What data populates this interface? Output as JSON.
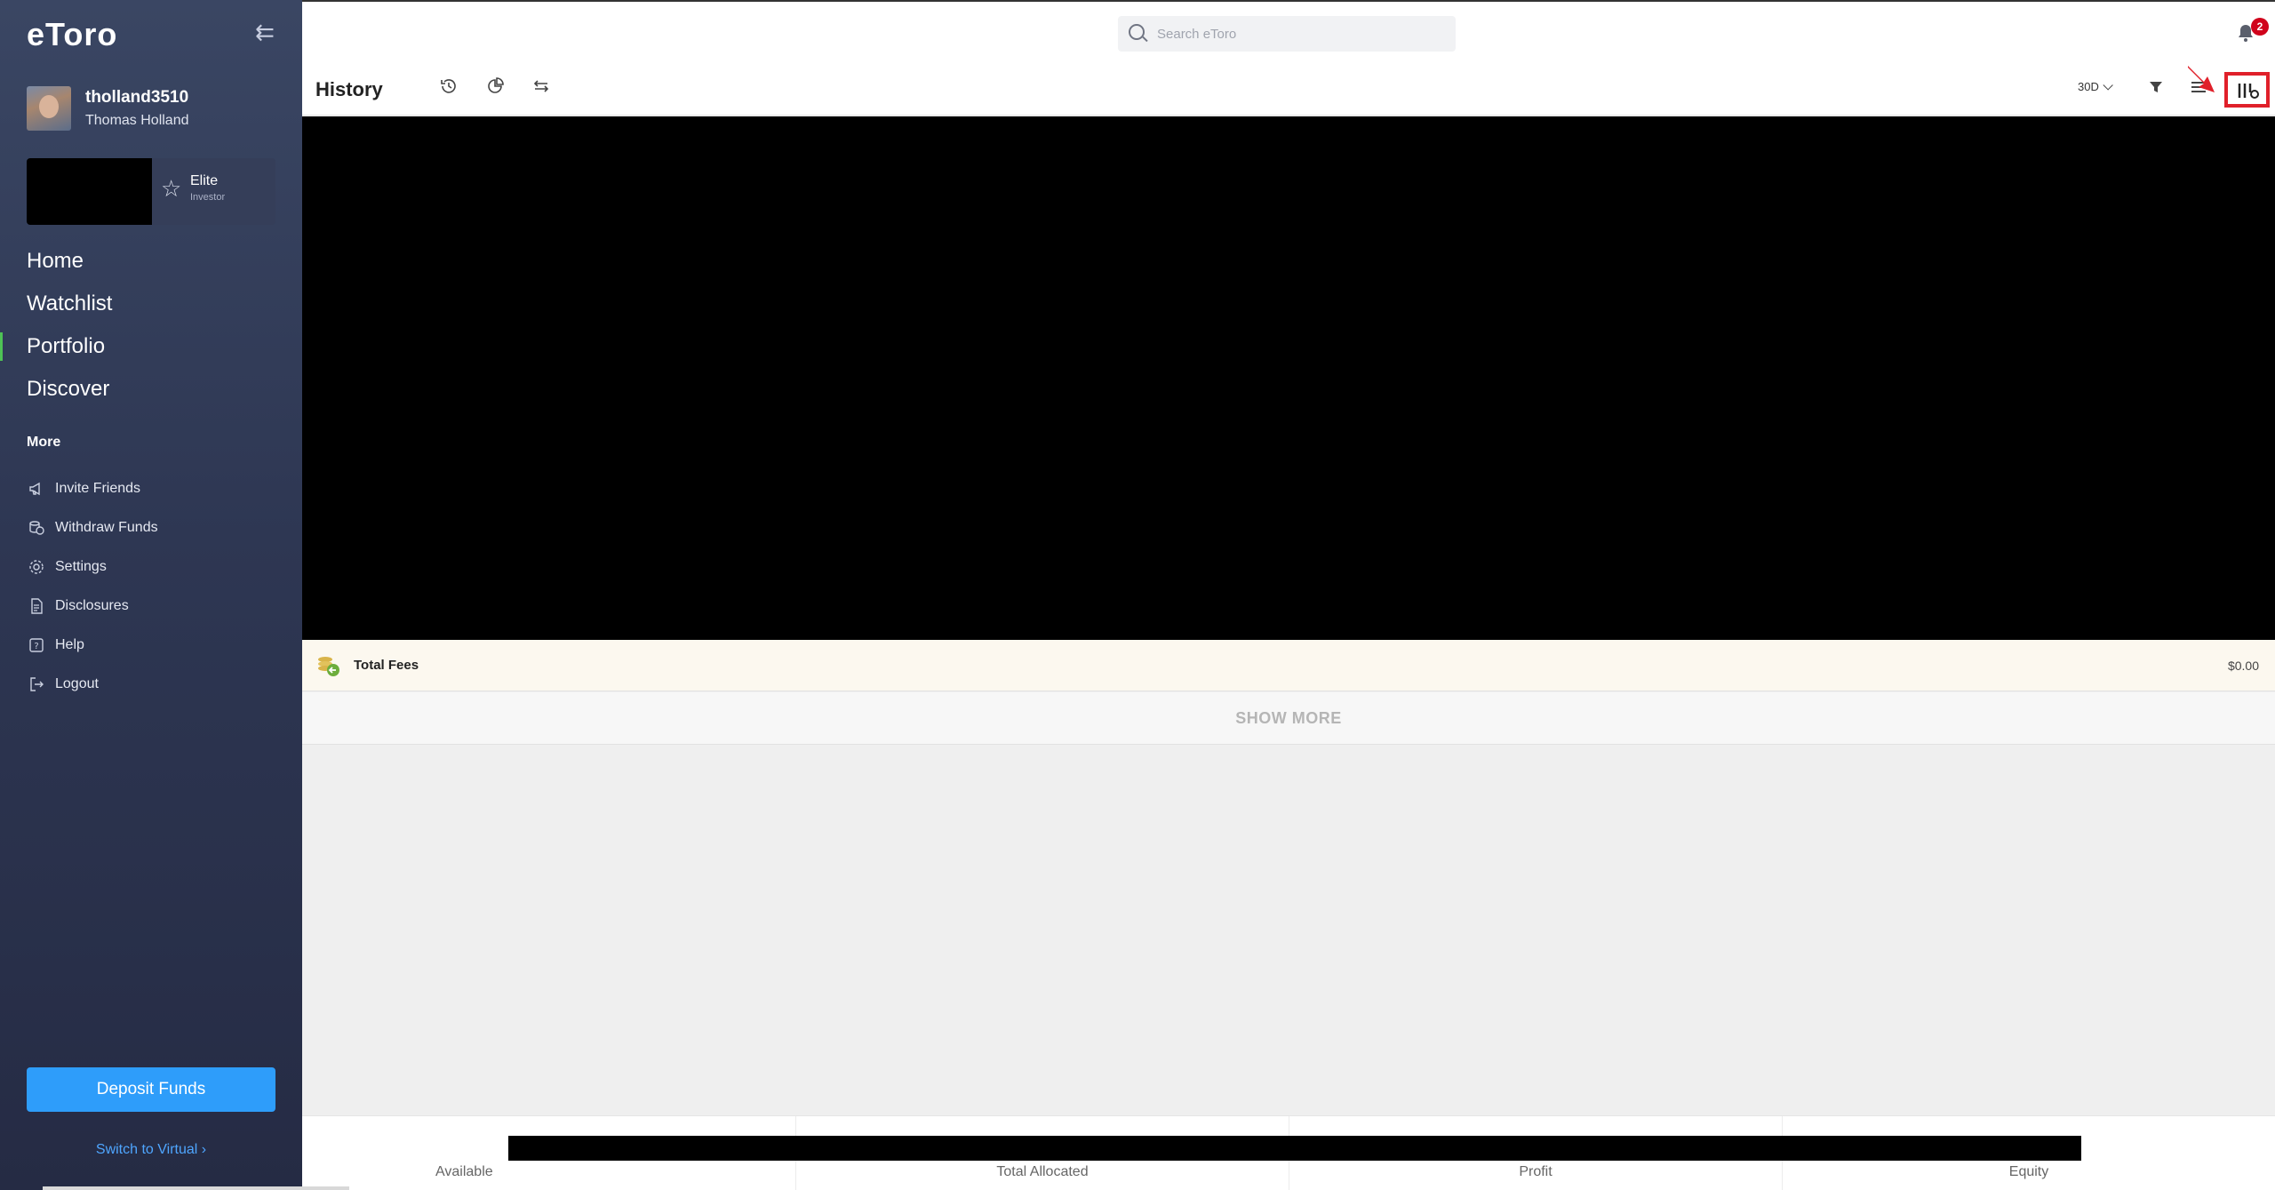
{
  "app": {
    "logo": "eToro"
  },
  "user": {
    "username": "tholland3510",
    "full_name": "Thomas Holland"
  },
  "club": {
    "title": "Elite",
    "subtitle": "Investor"
  },
  "nav": {
    "items": [
      {
        "label": "Home"
      },
      {
        "label": "Watchlist"
      },
      {
        "label": "Portfolio",
        "active": true
      },
      {
        "label": "Discover"
      }
    ]
  },
  "more": {
    "label": "More",
    "items": [
      {
        "label": "Invite Friends",
        "icon": "megaphone-icon"
      },
      {
        "label": "Withdraw Funds",
        "icon": "coins-icon"
      },
      {
        "label": "Settings",
        "icon": "gear-icon"
      },
      {
        "label": "Disclosures",
        "icon": "document-icon"
      },
      {
        "label": "Help",
        "icon": "help-icon"
      },
      {
        "label": "Logout",
        "icon": "logout-icon"
      }
    ]
  },
  "deposit_label": "Deposit Funds",
  "switch_label": "Switch to Virtual ›",
  "search": {
    "placeholder": "Search eToro"
  },
  "notifications": {
    "count": "2"
  },
  "header": {
    "title": "History",
    "period": "30D"
  },
  "fees": {
    "label": "Total Fees",
    "value": "$0.00"
  },
  "show_more": "SHOW MORE",
  "footer": {
    "labels": [
      "Available",
      "Total Allocated",
      "Profit",
      "Equity"
    ]
  },
  "colors": {
    "accent": "#2e9dfa",
    "active_nav": "#4ec255",
    "highlight": "#e0202a",
    "badge": "#d0021b"
  }
}
